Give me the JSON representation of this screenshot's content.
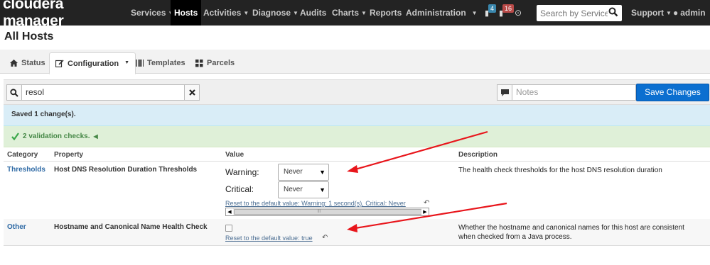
{
  "navbar": {
    "brand": "cloudera manager",
    "items": [
      {
        "label": "Services",
        "dropdown": true
      },
      {
        "label": "Hosts",
        "active": true
      },
      {
        "label": "Activities",
        "dropdown": true
      },
      {
        "label": "Diagnose",
        "dropdown": true
      },
      {
        "label": "Audits"
      },
      {
        "label": "Charts",
        "dropdown": true
      },
      {
        "label": "Reports"
      },
      {
        "label": "Administration",
        "dropdown": true
      }
    ],
    "badge_blue": "4",
    "badge_red": "16",
    "search_placeholder": "Search by Service.",
    "support_label": "Support",
    "user_label": "admin"
  },
  "page": {
    "title": "All Hosts"
  },
  "tabs": [
    {
      "label": "Status",
      "icon": "home-icon"
    },
    {
      "label": "Configuration",
      "icon": "edit-icon",
      "active": true,
      "dropdown": true
    },
    {
      "label": "Templates",
      "icon": "barcode-icon"
    },
    {
      "label": "Parcels",
      "icon": "parcels-icon"
    }
  ],
  "filter": {
    "search_value": "resol",
    "notes_placeholder": "Notes",
    "save_button": "Save Changes"
  },
  "alerts": {
    "info": "Saved 1 change(s).",
    "validation": "2 validation checks."
  },
  "table": {
    "headers": {
      "category": "Category",
      "property": "Property",
      "value": "Value",
      "description": "Description"
    },
    "rows": [
      {
        "category": "Thresholds",
        "property": "Host DNS Resolution Duration Thresholds",
        "warning_label": "Warning:",
        "warning_value": "Never",
        "critical_label": "Critical:",
        "critical_value": "Never",
        "reset_link": "Reset to the default value: Warning: 1 second(s), Critical: Never",
        "description": "The health check thresholds for the host DNS resolution duration"
      },
      {
        "category": "Other",
        "property": "Hostname and Canonical Name Health Check",
        "checked": false,
        "reset_link": "Reset to the default value: true",
        "description_line1": "Whether the hostname and canonical names for this host are consistent",
        "description_line2": "when checked from a Java process."
      }
    ]
  },
  "colors": {
    "navbar_bg": "#232323",
    "primary_button": "#0b6fd0",
    "info_alert": "#d9edf7",
    "success_alert": "#dff0d8",
    "link": "#2f6aa5",
    "annotation_arrow": "#e8151b"
  }
}
